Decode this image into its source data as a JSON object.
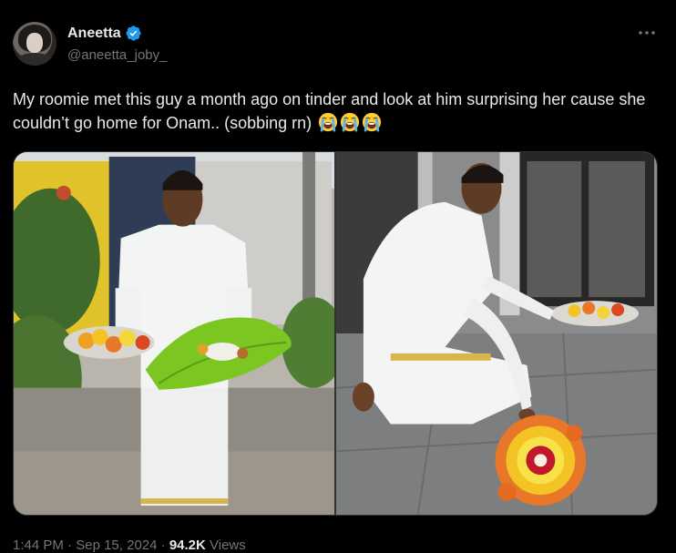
{
  "author": {
    "display_name": "Aneetta",
    "handle": "@aneetta_joby_",
    "verified": true
  },
  "tweet": {
    "text": "My roomie met this guy a month ago on tinder and look at him surprising her cause she couldn’t go home for Onam.. (sobbing rn)",
    "emojis": [
      "loudly-crying-face",
      "loudly-crying-face",
      "loudly-crying-face"
    ]
  },
  "meta": {
    "time": "1:44 PM",
    "separator": "·",
    "date": "Sep 15, 2024",
    "views_count": "94.2K",
    "views_label": "Views"
  },
  "colors": {
    "background": "#000000",
    "text_primary": "#e7e9ea",
    "text_secondary": "#71767b",
    "verified_blue": "#1d9bf0",
    "border": "#2f3336"
  }
}
